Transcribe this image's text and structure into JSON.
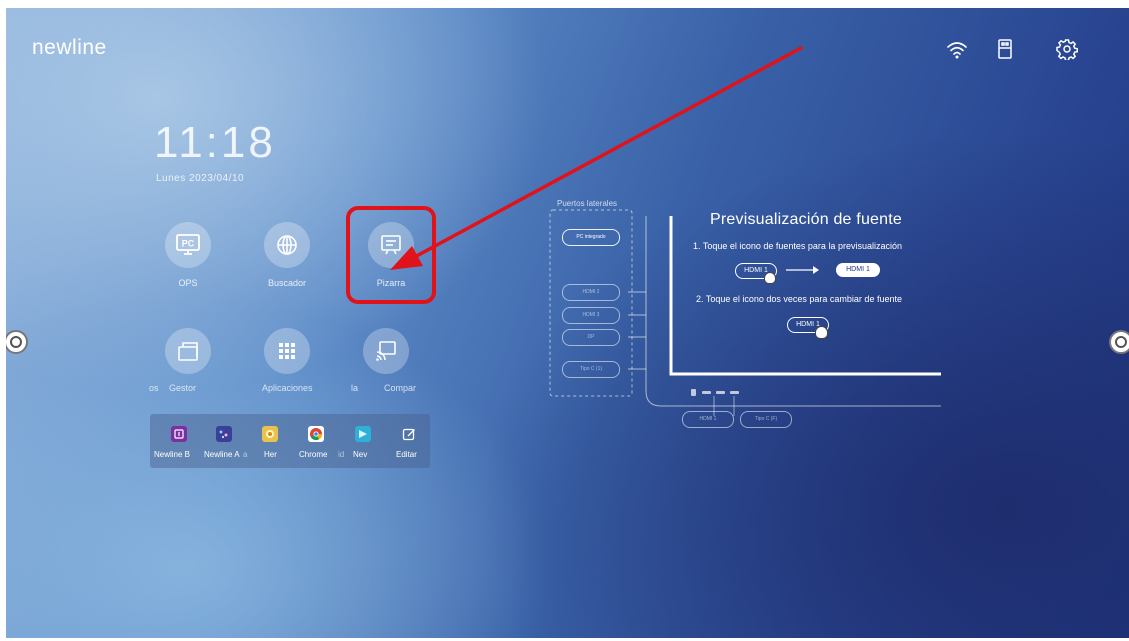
{
  "brand": "newline",
  "topbar": {
    "icons": [
      "wifi-icon",
      "usb-icon",
      "settings-icon"
    ]
  },
  "clock": {
    "time": "11:18",
    "date": "Lunes 2023/04/10"
  },
  "apps_row1": [
    {
      "label": "OPS",
      "icon": "pc-icon"
    },
    {
      "label": "Buscador",
      "icon": "globe-icon"
    },
    {
      "label": "Pizarra",
      "icon": "whiteboard-icon"
    }
  ],
  "apps_row2": [
    {
      "label": "Gestor",
      "icon": "file-manager-icon"
    },
    {
      "label": "Aplicaciones",
      "icon": "apps-grid-icon"
    },
    {
      "label": "Compar",
      "icon": "screen-share-icon"
    }
  ],
  "apps_row2_partial": {
    "left": "os",
    "middle": "la"
  },
  "dock": {
    "items": [
      {
        "label": "Newline B",
        "color": "#7b2fa0"
      },
      {
        "label": "Newline A",
        "color": "#3a3f9a"
      },
      {
        "label": "Her",
        "color": "#e8c24a"
      },
      {
        "label": "Chrome",
        "color": "#ffffff"
      },
      {
        "label": "Nev",
        "color": "#2fb0d6"
      },
      {
        "label": "Editar",
        "color": "transparent"
      }
    ],
    "fragments": [
      "a",
      "id"
    ]
  },
  "ports_panel": {
    "title": "Puertos laterales",
    "ports": [
      "PC integrado",
      "HDMI 2",
      "HDMI 3",
      "DP",
      "Tipo C (1)"
    ],
    "bottom_ports": [
      "HDMI 1",
      "Tipo C (F)"
    ]
  },
  "preview": {
    "title": "Previsualización de fuente",
    "step1": "1. Toque el icono de fuentes para la previsualización",
    "step2": "2. Toque el icono dos veces para cambiar de fuente",
    "pill_source": "HDMI 1",
    "pill_target": "HDMI 1",
    "pill_double": "HDMI 1"
  },
  "colors": {
    "highlight": "#e0121a",
    "arrow": "#e0121a"
  }
}
